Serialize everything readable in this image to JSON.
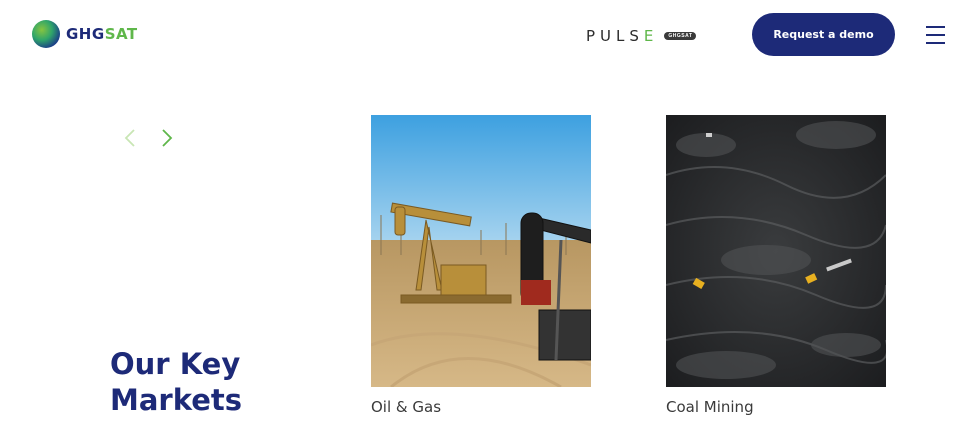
{
  "header": {
    "logo_text_primary": "GHG",
    "logo_text_secondary": "SAT",
    "pulse_text": "PULS",
    "pulse_text_accent": "E",
    "pulse_badge": "GHGSAT",
    "demo_button_label": "Request a demo",
    "menu_icon": "hamburger-menu-icon"
  },
  "carousel": {
    "prev_icon": "chevron-left-icon",
    "next_icon": "chevron-right-icon"
  },
  "section": {
    "title": "Our Key Markets"
  },
  "markets": [
    {
      "label": "Oil & Gas",
      "image": "oil-pump-jacks-photo"
    },
    {
      "label": "Coal Mining",
      "image": "coal-mine-aerial-photo"
    }
  ],
  "colors": {
    "brand_navy": "#1d2a78",
    "brand_green": "#5fb74a"
  }
}
